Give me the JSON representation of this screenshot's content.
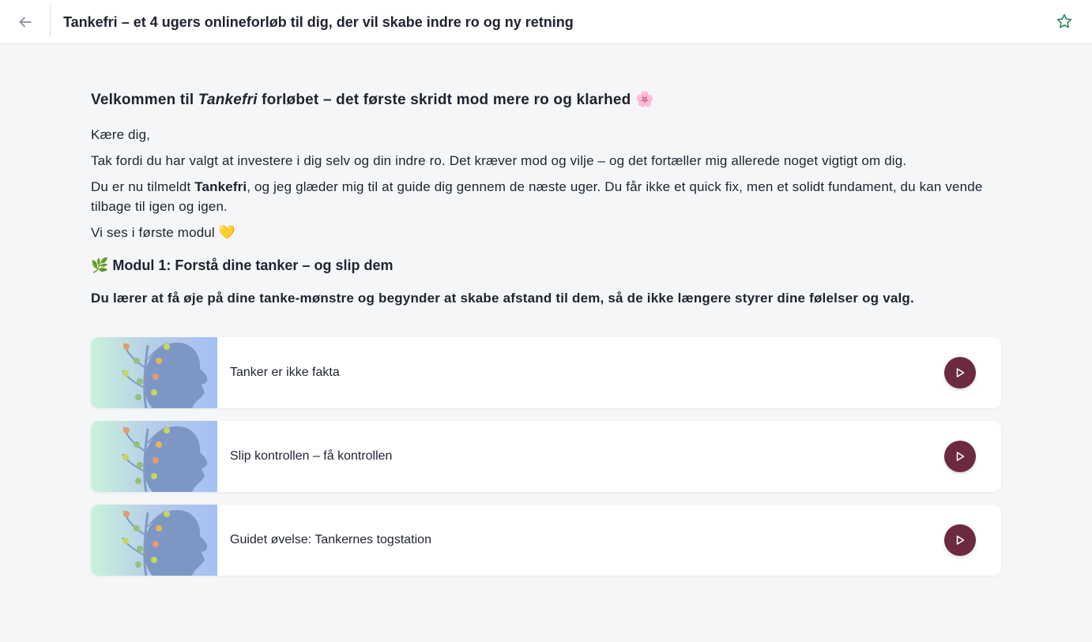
{
  "header": {
    "title": "Tankefri – et 4 ugers onlineforløb til dig, der vil skabe indre ro og ny retning",
    "back_icon": "arrow-left-icon",
    "favorite_icon": "star-outline-icon",
    "accent_color": "#2e8b57"
  },
  "intro": {
    "heading_pre": "Velkommen til ",
    "heading_em": "Tankefri",
    "heading_post": " forløbet – det første skridt mod mere ro og klarhed 🌸",
    "greeting": "Kære dig,",
    "thanks": "Tak fordi du har valgt at investere i dig selv og din indre ro. Det kræver mod og vilje – og det fortæller mig allerede noget vigtigt om dig.",
    "enrolled_pre": "Du er nu tilmeldt ",
    "enrolled_bold": "Tankefri",
    "enrolled_post": ", og jeg glæder mig til at guide dig gennem de næste uger. Du får ikke et quick fix, men et solidt fundament, du kan vende tilbage til igen og igen.",
    "see_you": "Vi ses i første modul 💛"
  },
  "module": {
    "heading": "🌿 Modul 1: Forstå dine tanker – og slip dem",
    "description": "Du lærer at få øje på dine tanke-mønstre og begynder at skabe afstand til dem, så de ikke længere styrer dine følelser og valg."
  },
  "lessons": [
    {
      "title": "Tanker er ikke fakta",
      "icon": "play-icon"
    },
    {
      "title": "Slip kontrollen – få kontrollen",
      "icon": "play-icon"
    },
    {
      "title": "Guidet øvelse: Tankernes togstation",
      "icon": "play-icon"
    }
  ],
  "colors": {
    "play_button": "#6b2a42",
    "background": "#f5f6f8"
  }
}
